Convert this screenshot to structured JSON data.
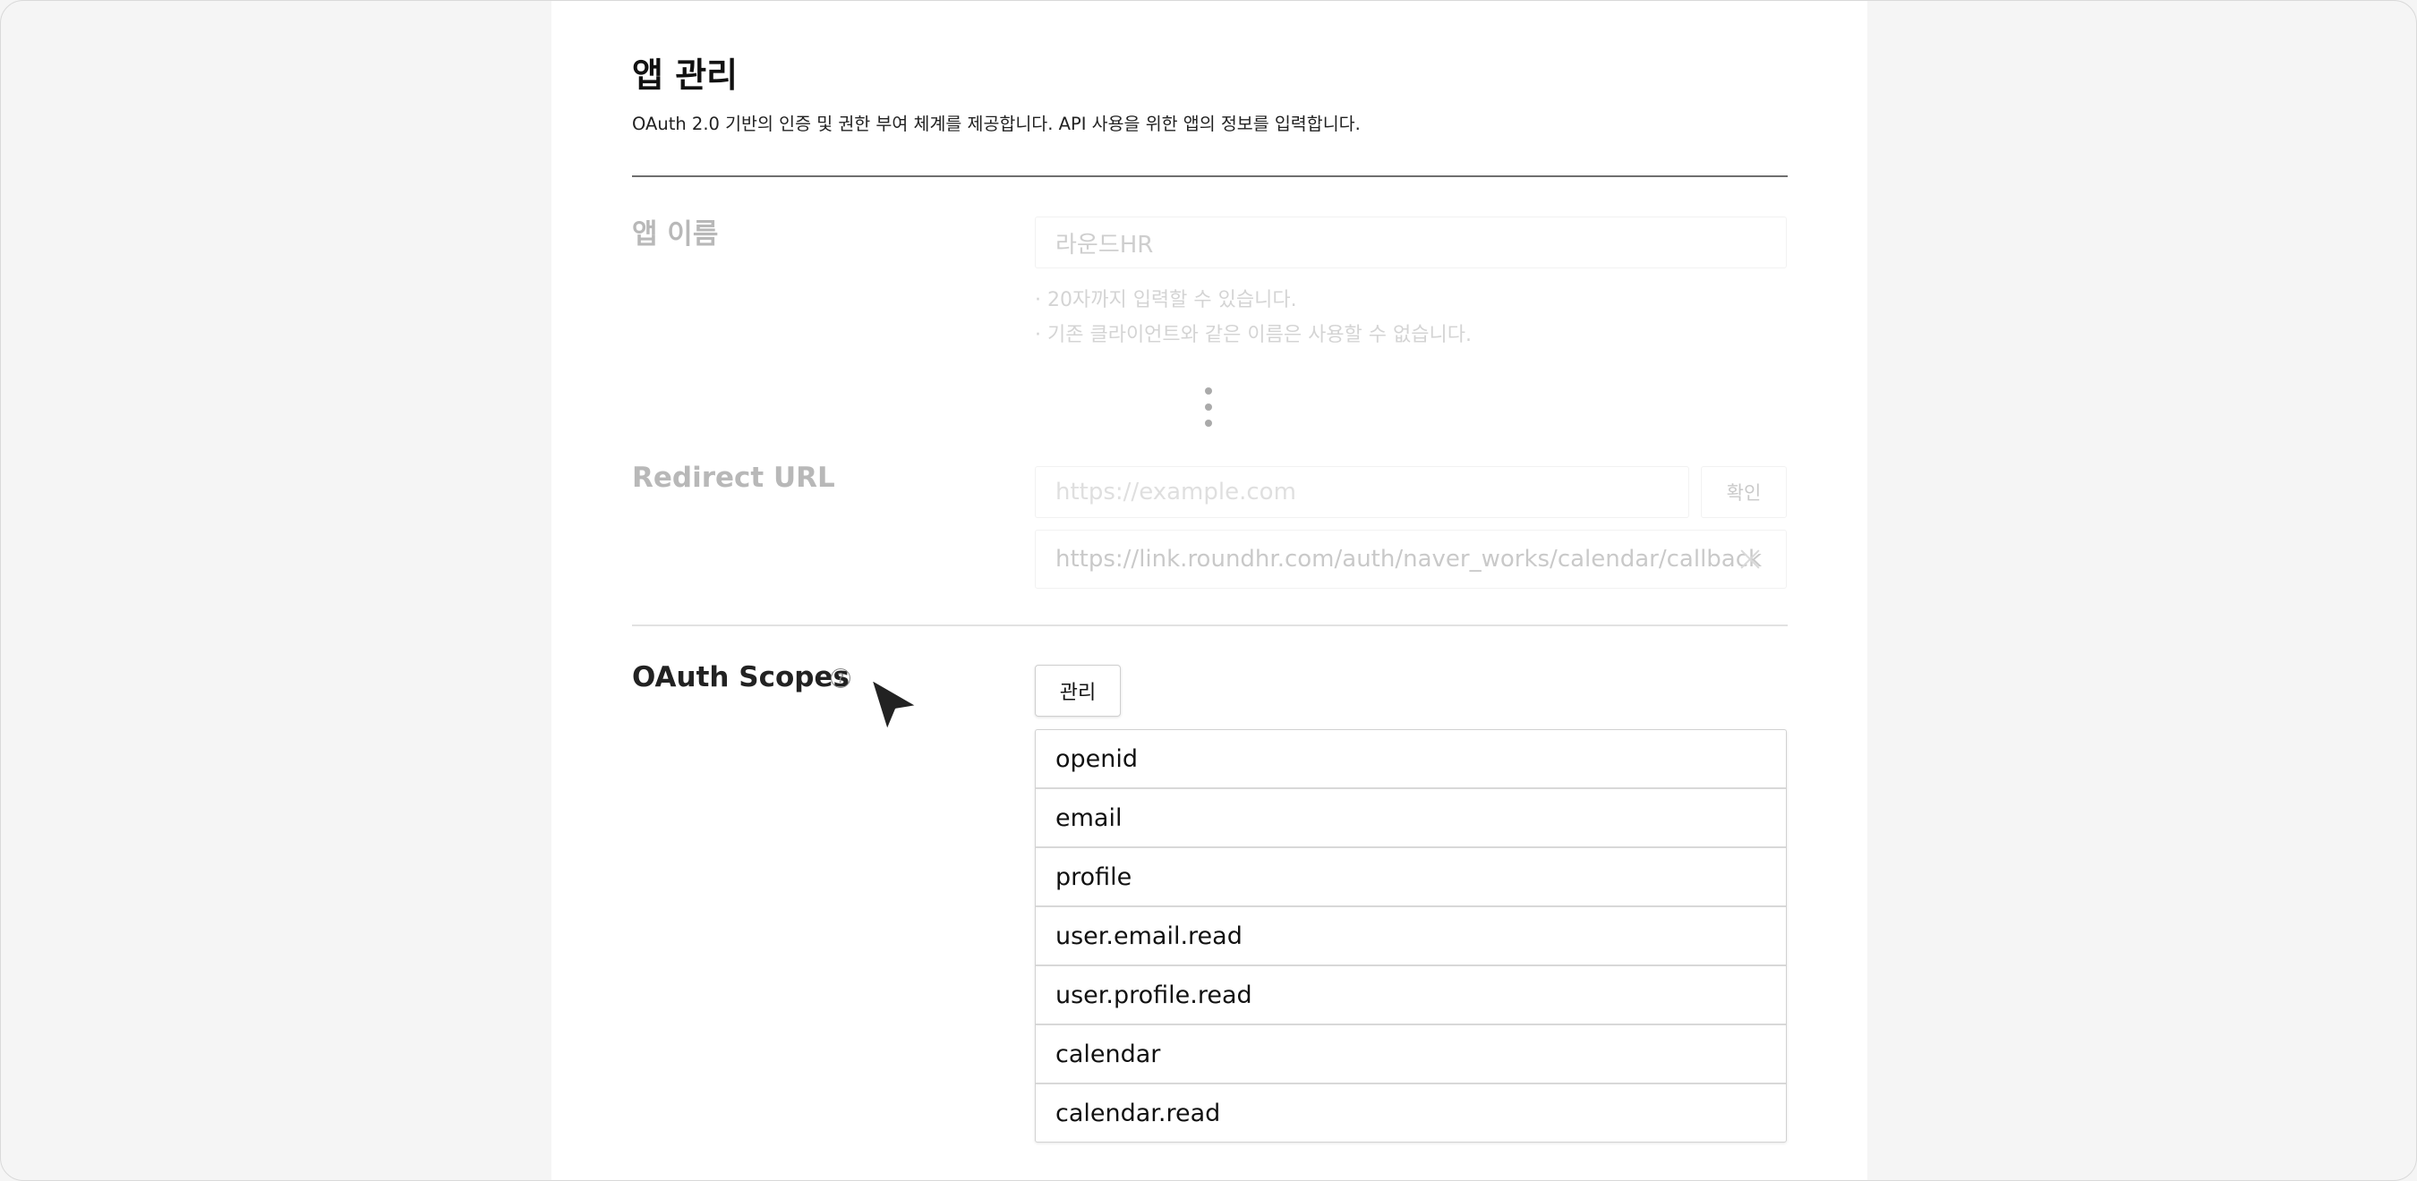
{
  "header": {
    "title": "앱 관리",
    "description": "OAuth 2.0 기반의 인증 및 권한 부여 체계를 제공합니다. API 사용을 위한 앱의 정보를 입력합니다."
  },
  "app_name": {
    "label": "앱 이름",
    "value": "라운드HR",
    "hints": [
      "· 20자까지 입력할 수 있습니다.",
      "· 기존 클라이언트와 같은 이름은 사용할 수 없습니다."
    ]
  },
  "redirect": {
    "label": "Redirect URL",
    "placeholder": "https://example.com",
    "confirm_label": "확인",
    "entries": [
      "https://link.roundhr.com/auth/naver_works/calendar/callback"
    ]
  },
  "scopes": {
    "label": "OAuth Scopes",
    "help_icon": "question-circle-icon",
    "manage_label": "관리",
    "items": [
      "openid",
      "email",
      "profile",
      "user.email.read",
      "user.profile.read",
      "calendar",
      "calendar.read"
    ]
  }
}
